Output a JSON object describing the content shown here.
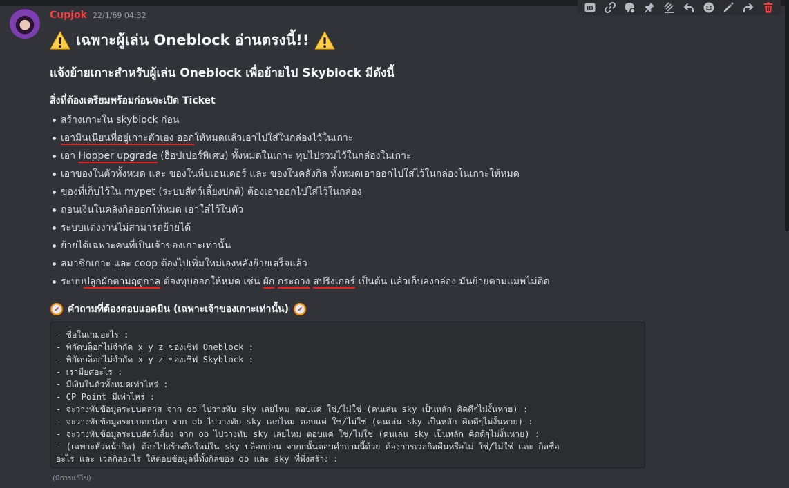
{
  "message": {
    "username": "Cupjok",
    "timestamp": "22/1/69 04:32",
    "edited_label": "(มีการแก้ไข)",
    "heading1": "เฉพาะผู้เล่น Oneblock อ่านตรงนี้!!",
    "heading2": "แจ้งย้ายเกาะสำหรับผู้เล่น Oneblock เพื่อย้ายไป Skyblock มีดังนี้",
    "heading3": "สิ่งที่ต้องเตรียมพร้อมก่อนจะเปิด Ticket",
    "list": [
      {
        "text": "สร้างเกาะใน skyblock ก่อน"
      },
      {
        "u": "เอามินเนียนที่อยู่เกาะตัวเอง ออก",
        "rest": "ให้หมดแล้วเอาไปใส่ในกล่องไว้ในเกาะ"
      },
      {
        "pre": "เอา ",
        "u": "Hopper upgrade",
        "rest": " (ฮ็อปเปอร์พิเศษ) ทั้งหมดในเกาะ ทุบไปรวมไว้ในกล่องในเกาะ"
      },
      {
        "text": "เอาของในตัวทั้งหมด และ ของในหีบเอนเดอร์ และ ของในคลังกิล ทั้งหมดเอาออกไปใส่ไว้ในกล่องในเกาะให้หมด"
      },
      {
        "text": "ของที่เก็บไว้ใน mypet (ระบบสัตว์เลี้ยงปกติ) ต้องเอาออกไปใส่ไว้ในกล่อง"
      },
      {
        "text": "ถอนเงินในคลังกิลออกให้หมด เอาใส่ไว้ในตัว"
      },
      {
        "text": "ระบบแต่งงานไม่สามารถย้ายได้"
      },
      {
        "text": "ย้ายได้เฉพาะคนที่เป็นเจ้าของเกาะเท่านั้น"
      },
      {
        "text": "สมาชิกเกาะ และ coop ต้องไปเพิ่มใหม่เองหลังย้ายเสร็จแล้ว"
      },
      {
        "pre": "ระบบ",
        "u": "ปลูกผักตามฤดูกาล",
        "mid1": " ต้องทุบออกให้หมด เช่น ",
        "u2": "ผัก",
        "mid2": " ",
        "u3": "กระถาง",
        "mid3": " ",
        "u4": "สปริงเกอร์",
        "rest": " เป็นต้น แล้วเก็บลงกล่อง มันย้ายตามแมพไม่ติด"
      }
    ],
    "heading4": "คำถามที่ต้องตอบแอดมิน (เฉพาะเจ้าของเกาะเท่านั้น)",
    "code_lines": [
      "- ชื่อในเกมอะไร :",
      "- พิกัดบล็อกไม่จำกัด x y z ของเซิฟ Oneblock :",
      "- พิกัดบล็อกไม่จำกัด x y z ของเซิฟ Skyblock :",
      "- เรามียศอะไร :",
      "- มีเงินในตัวทั้งหมดเท่าไหร่ :",
      "- CP Point มีเท่าไหร่ :",
      "- จะวางทับข้อมูลระบบคลาส จาก ob ไปวางทับ sky เลยไหม ตอบแค่ ใช่/ไม่ใช่ (คนเล่น sky เป็นหลัก คิดดีๆไม่งั้นหาย) :",
      "- จะวางทับข้อมูลระบบตกปลา จาก ob ไปวางทับ sky เลยไหม ตอบแค่ ใช่/ไม่ใช่ (คนเล่น sky เป็นหลัก คิดดีๆไม่งั้นหาย) :",
      "- จะวางทับข้อมูลระบบสัตว์เลี้ยง จาก ob ไปวางทับ sky เลยไหม ตอบแค่ ใช่/ไม่ใช่ (คนเล่น sky เป็นหลัก คิดดีๆไม่งั้นหาย) :",
      "- (เฉพาะหัวหน้ากิล) ต้องไปสร้างกิลใหม่ใน sky บล็อกก่อน จากกนั้นตอบคำถามนี้ด้วย ต้องการเวลกิลคืนหรือไม่ ใช่/ไม่ใช่ และ กิลชื่อ",
      "อะไร และ เวลกิลอะไร ให้ตอบข้อมูลนี้ทั้งกิลของ ob และ sky ที่พึ่งสร้าง :"
    ]
  },
  "toolbar": {
    "icons": [
      "id-icon",
      "link-icon",
      "thread-icon",
      "pin-icon",
      "forward-multi-icon",
      "reply-icon",
      "reaction-icon",
      "edit-icon",
      "forward-icon",
      "delete-icon"
    ],
    "danger_color": "#f23f42"
  }
}
